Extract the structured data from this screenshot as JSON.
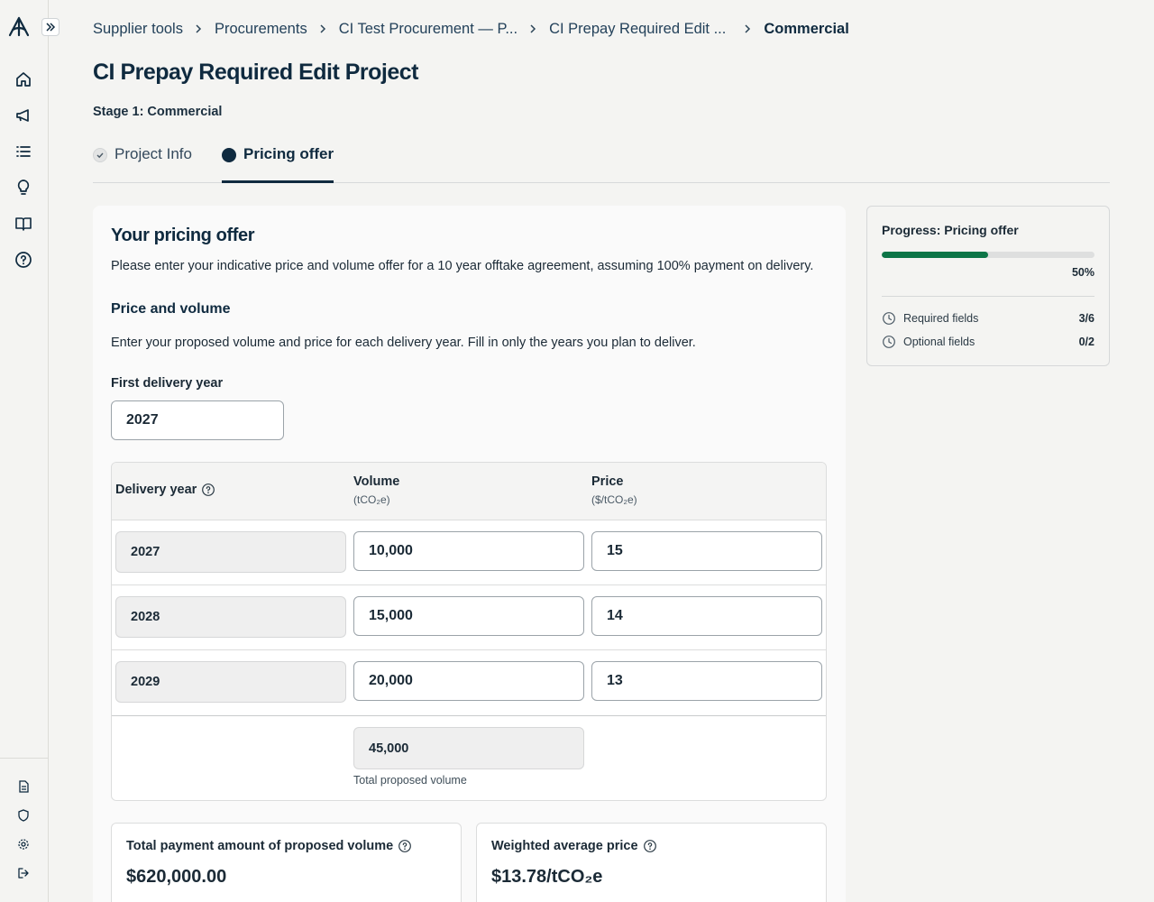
{
  "breadcrumb": {
    "items": [
      "Supplier tools",
      "Procurements",
      "CI Test Procurement — P...",
      "CI Prepay Required Edit ..."
    ],
    "current": "Commercial"
  },
  "page_title": "CI Prepay Required Edit Project",
  "stage_label": "Stage 1: Commercial",
  "tabs": [
    {
      "label": "Project Info",
      "state": "complete"
    },
    {
      "label": "Pricing offer",
      "state": "active"
    }
  ],
  "offer": {
    "title": "Your pricing offer",
    "description": "Please enter your indicative price and volume offer for a 10 year offtake agreement, assuming 100% payment on delivery.",
    "section_title": "Price and volume",
    "section_description": "Enter your proposed volume and price for each delivery year. Fill in only the years you plan to deliver.",
    "first_delivery_year_label": "First delivery year",
    "first_delivery_year_value": "2027"
  },
  "table": {
    "headers": {
      "year": "Delivery year",
      "volume": "Volume",
      "volume_unit": "(tCO₂e)",
      "price": "Price",
      "price_unit": "($/tCO₂e)"
    },
    "rows": [
      {
        "year": "2027",
        "volume": "10,000",
        "price": "15"
      },
      {
        "year": "2028",
        "volume": "15,000",
        "price": "14"
      },
      {
        "year": "2029",
        "volume": "20,000",
        "price": "13"
      }
    ],
    "total_volume": "45,000",
    "total_volume_label": "Total proposed volume"
  },
  "summary": {
    "total_payment_label": "Total payment amount of proposed volume",
    "total_payment_value": "$620,000.00",
    "weighted_price_label": "Weighted average price",
    "weighted_price_value": "$13.78/tCO₂e"
  },
  "progress": {
    "title": "Progress: Pricing offer",
    "percent_label": "50%",
    "fraction": 0.5,
    "required_label": "Required fields",
    "required_count": "3/6",
    "optional_label": "Optional fields",
    "optional_count": "0/2"
  },
  "sidebar": {
    "icons": [
      "home-icon",
      "megaphone-icon",
      "list-icon",
      "lightbulb-icon",
      "book-icon",
      "help-circle-icon"
    ],
    "bottom_icons": [
      "document-icon",
      "shield-icon",
      "settings-icon",
      "logout-icon"
    ]
  },
  "colors": {
    "primary": "#0f2a3f",
    "progress": "#0d7547",
    "background": "#f4f4f2"
  }
}
